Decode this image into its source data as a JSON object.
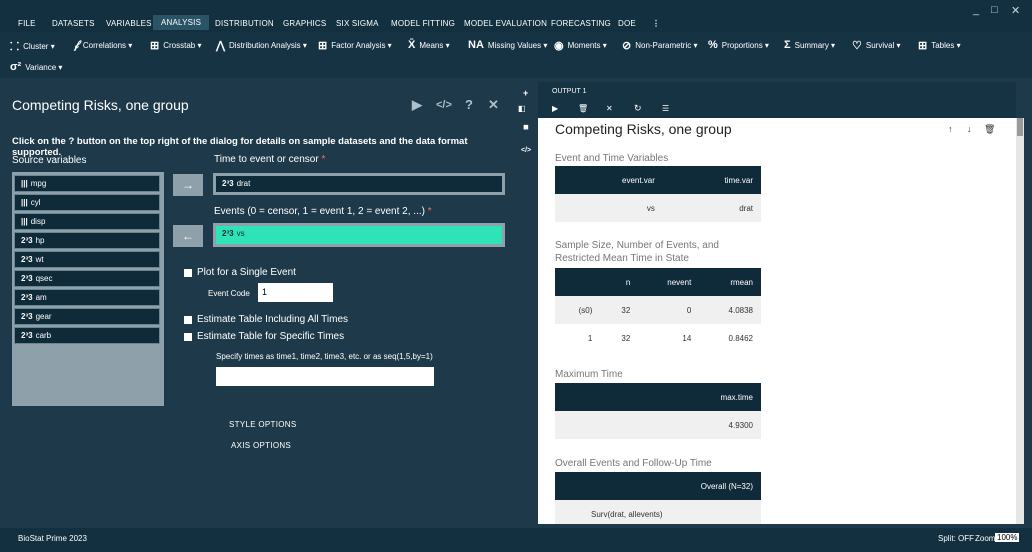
{
  "menu": {
    "items": [
      "FILE",
      "DATASETS",
      "VARIABLES",
      "ANALYSIS",
      "DISTRIBUTION",
      "GRAPHICS",
      "SIX SIGMA",
      "MODEL FITTING",
      "MODEL EVALUATION",
      "FORECASTING",
      "DOE"
    ],
    "more": "⋮",
    "active": "ANALYSIS"
  },
  "window": {
    "minimize": "_",
    "maximize": "□",
    "close": "✕"
  },
  "toolbar": {
    "items": [
      {
        "icon": "⸬",
        "label": "Cluster ▾"
      },
      {
        "icon": "𝒻",
        "label": "Correlations ▾"
      },
      {
        "icon": "⊞",
        "label": "Crosstab ▾"
      },
      {
        "icon": "⋀",
        "label": "Distribution Analysis ▾"
      },
      {
        "icon": "⊞",
        "label": "Factor Analysis ▾"
      },
      {
        "icon": "X̄",
        "label": "Means ▾"
      },
      {
        "icon": "NA",
        "label": "Missing Values ▾"
      },
      {
        "icon": "◉",
        "label": "Moments ▾"
      },
      {
        "icon": "⊘",
        "label": "Non-Parametric ▾"
      },
      {
        "icon": "%",
        "label": "Proportions ▾"
      },
      {
        "icon": "Σ",
        "label": "Summary ▾"
      },
      {
        "icon": "♡",
        "label": "Survival ▾"
      },
      {
        "icon": "⊞",
        "label": "Tables ▾"
      }
    ],
    "row2": {
      "icon": "σ²",
      "label": "Variance ▾"
    }
  },
  "dialog": {
    "title": "Competing Risks, one group",
    "run_icon": "▶",
    "code_icon": "</>",
    "help_icon": "?",
    "close_icon": "✕",
    "help_text": "Click on the ? button on the top right of the dialog for details on sample datasets and the data format supported.",
    "source_label": "Source variables",
    "variables": [
      {
        "icon": "|||",
        "name": "mpg"
      },
      {
        "icon": "|||",
        "name": "cyl"
      },
      {
        "icon": "|||",
        "name": "disp"
      },
      {
        "icon": "2³3",
        "name": "hp"
      },
      {
        "icon": "2³3",
        "name": "wt"
      },
      {
        "icon": "2³3",
        "name": "qsec"
      },
      {
        "icon": "2³3",
        "name": "am"
      },
      {
        "icon": "2³3",
        "name": "gear"
      },
      {
        "icon": "2³3",
        "name": "carb"
      }
    ],
    "move_right": "→",
    "move_left": "←",
    "time_label": "Time to event or censor",
    "time_value_icon": "2³3",
    "time_value": "drat",
    "events_label": "Events (0 = censor, 1 = event 1, 2 = event 2, ...)",
    "events_value_icon": "2³3",
    "events_value": "vs",
    "required_mark": "*",
    "plot_single_label": "Plot for a Single Event",
    "event_code_label": "Event Code",
    "event_code_value": "1",
    "est_all_label": "Estimate Table Including All Times",
    "est_specific_label": "Estimate Table for Specific Times",
    "specify_times_label": "Specify times as time1, time2, time3, etc. or as seq(1,5,by=1)",
    "specify_times_value": "",
    "style_options": "STYLE OPTIONS",
    "axis_options": "AXIS OPTIONS"
  },
  "output": {
    "tab_label": "OUTPUT 1",
    "side_icons": [
      "+",
      "◼",
      "</>"
    ],
    "tab_icons": [
      "◧",
      "▶",
      "🗑",
      "✕",
      "↻",
      "☰"
    ],
    "title": "Competing Risks, one group",
    "ctrl_icons": [
      "↑",
      "↓",
      "🗑"
    ],
    "sections": [
      {
        "title": "Event and Time Variables",
        "headers": [
          "event.var",
          "time.var"
        ],
        "rows": [
          [
            "vs",
            "drat"
          ]
        ]
      },
      {
        "title": "Sample Size, Number of Events, and Restricted Mean Time in State",
        "headers": [
          "",
          "n",
          "nevent",
          "rmean"
        ],
        "rows": [
          [
            "(s0)",
            "32",
            "0",
            "4.0838"
          ],
          [
            "1",
            "32",
            "14",
            "0.8462"
          ]
        ]
      },
      {
        "title": "Maximum Time",
        "headers": [
          "max.time"
        ],
        "rows": [
          [
            "4.9300"
          ]
        ]
      },
      {
        "title": "Overall Events and Follow-Up Time",
        "headers": [
          "Overall (N=32)"
        ],
        "rows": [
          [
            "Surv(drat, allevents)"
          ]
        ]
      }
    ]
  },
  "status": {
    "app_name": "BioStat Prime 2023",
    "split": "Split: OFF",
    "zoom_label": "Zoom:",
    "zoom_value": "100%"
  }
}
